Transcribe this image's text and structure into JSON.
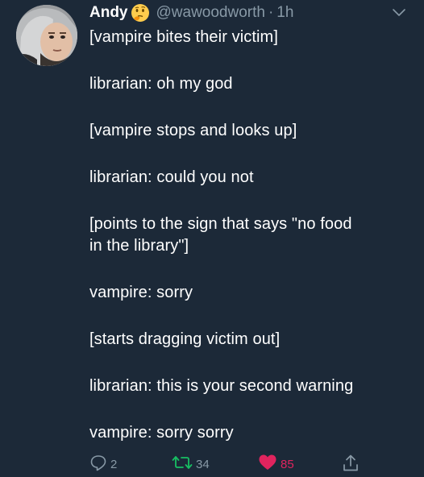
{
  "author": {
    "display_name": "Andy",
    "handle": "@wawoodworth",
    "separator": "·",
    "time": "1h",
    "emoji": "thinking-face-emoji"
  },
  "lines": [
    "[vampire bites their victim]",
    "",
    "librarian: oh my god",
    "",
    "[vampire stops and looks up]",
    "",
    "librarian: could you not",
    "",
    "[points to the sign that says \"no food",
    "in the library\"]",
    "",
    "vampire: sorry",
    "",
    "[starts dragging victim out]",
    "",
    "librarian: this is your second warning",
    "",
    "vampire: sorry sorry"
  ],
  "actions": {
    "reply_count": "2",
    "retweet_count": "34",
    "like_count": "85"
  },
  "colors": {
    "background": "#1c2938",
    "text": "#ffffff",
    "secondary": "#8899a6",
    "retweet": "#17bf63",
    "like": "#e0245e"
  }
}
